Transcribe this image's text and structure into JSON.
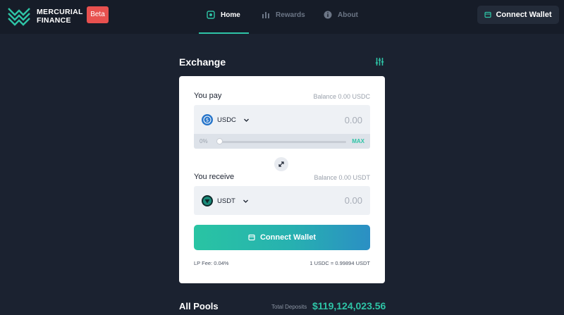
{
  "header": {
    "brand_line1": "MERCURIAL",
    "brand_line2": "FINANCE",
    "beta_label": "Beta",
    "nav": {
      "home": "Home",
      "rewards": "Rewards",
      "about": "About"
    },
    "active_tab": "Home",
    "connect_label": "Connect Wallet"
  },
  "exchange": {
    "title": "Exchange",
    "pay": {
      "label": "You pay",
      "balance": "Balance 0.00 USDC",
      "token": "USDC",
      "amount": "0.00",
      "slider_min_label": "0%",
      "slider_max_label": "MAX",
      "slider_value": 0
    },
    "receive": {
      "label": "You receive",
      "balance": "Balance 0.00 USDT",
      "token": "USDT",
      "amount": "0.00"
    },
    "connect_label": "Connect Wallet",
    "lp_fee": "LP Fee: 0.04%",
    "rate": "1 USDC = 0.99894 USDT"
  },
  "pools": {
    "title": "All Pools",
    "total_label": "Total Deposits",
    "total_value": "$119,124,023.56"
  },
  "colors": {
    "background": "#1b2230",
    "accent": "#2ec4a6",
    "beta": "#e8514f",
    "usdc": "#2775ca",
    "usdt": "#1a8b7a"
  },
  "icons": [
    "mercurial-logo-icon",
    "home-icon",
    "rewards-icon",
    "info-icon",
    "wallet-icon",
    "settings-sliders-icon",
    "usdc-icon",
    "usdt-icon",
    "chevron-down-icon",
    "swap-arrows-icon"
  ]
}
